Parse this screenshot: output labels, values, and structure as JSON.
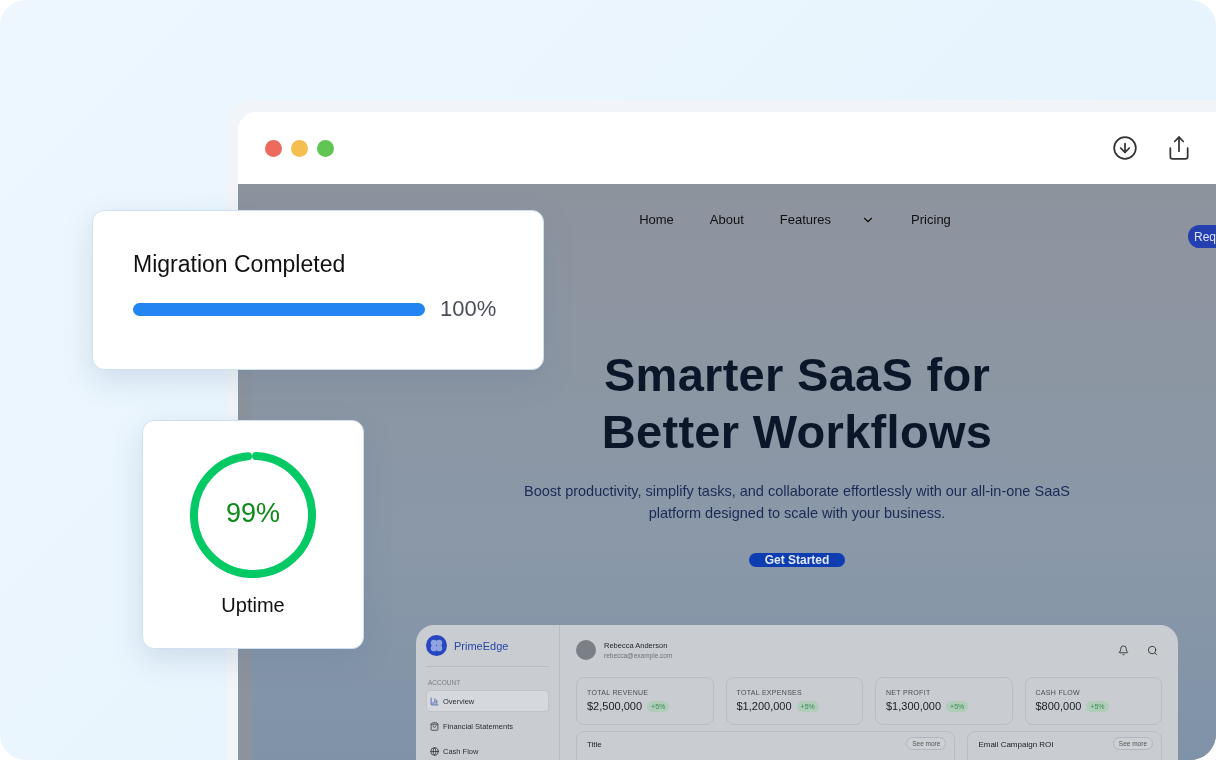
{
  "nav": {
    "items": [
      {
        "label": "Home",
        "kind": "link"
      },
      {
        "label": "About",
        "kind": "link"
      },
      {
        "label": "Features",
        "kind": "dropdown"
      },
      {
        "label": "Pricing",
        "kind": "link"
      }
    ],
    "cta": "Req"
  },
  "hero": {
    "title": "Smarter SaaS for Better Workflows",
    "subtitle": "Boost productivity, simplify tasks, and collaborate effortlessly with our all-in-one SaaS platform designed to scale with your business.",
    "button": "Get Started"
  },
  "dashboard": {
    "brand": "PrimeEdge",
    "section": "ACCOUNT",
    "menu": [
      {
        "label": "Overview",
        "selected": true
      },
      {
        "label": "Financial Statements",
        "selected": false
      },
      {
        "label": "Cash Flow",
        "selected": false
      }
    ],
    "user": {
      "name": "Rebecca Anderson",
      "email": "rebecca@example.com"
    },
    "stats": [
      {
        "label": "TOTAL REVENUE",
        "value": "$2,500,000",
        "change": "+5%"
      },
      {
        "label": "TOTAL EXPENSES",
        "value": "$1,200,000",
        "change": "+5%"
      },
      {
        "label": "NET PROFIT",
        "value": "$1,300,000",
        "change": "+5%"
      },
      {
        "label": "CASH FLOW",
        "value": "$800,000",
        "change": "+5%"
      }
    ],
    "panels": [
      {
        "title": "Title",
        "action": "See more"
      },
      {
        "title": "Email Campaign ROI",
        "action": "See more"
      }
    ]
  },
  "migration": {
    "title": "Migration Completed",
    "level": 1,
    "reading": "100%"
  },
  "uptime": {
    "level": 0.99,
    "reading": "99%",
    "label": "Uptime"
  }
}
